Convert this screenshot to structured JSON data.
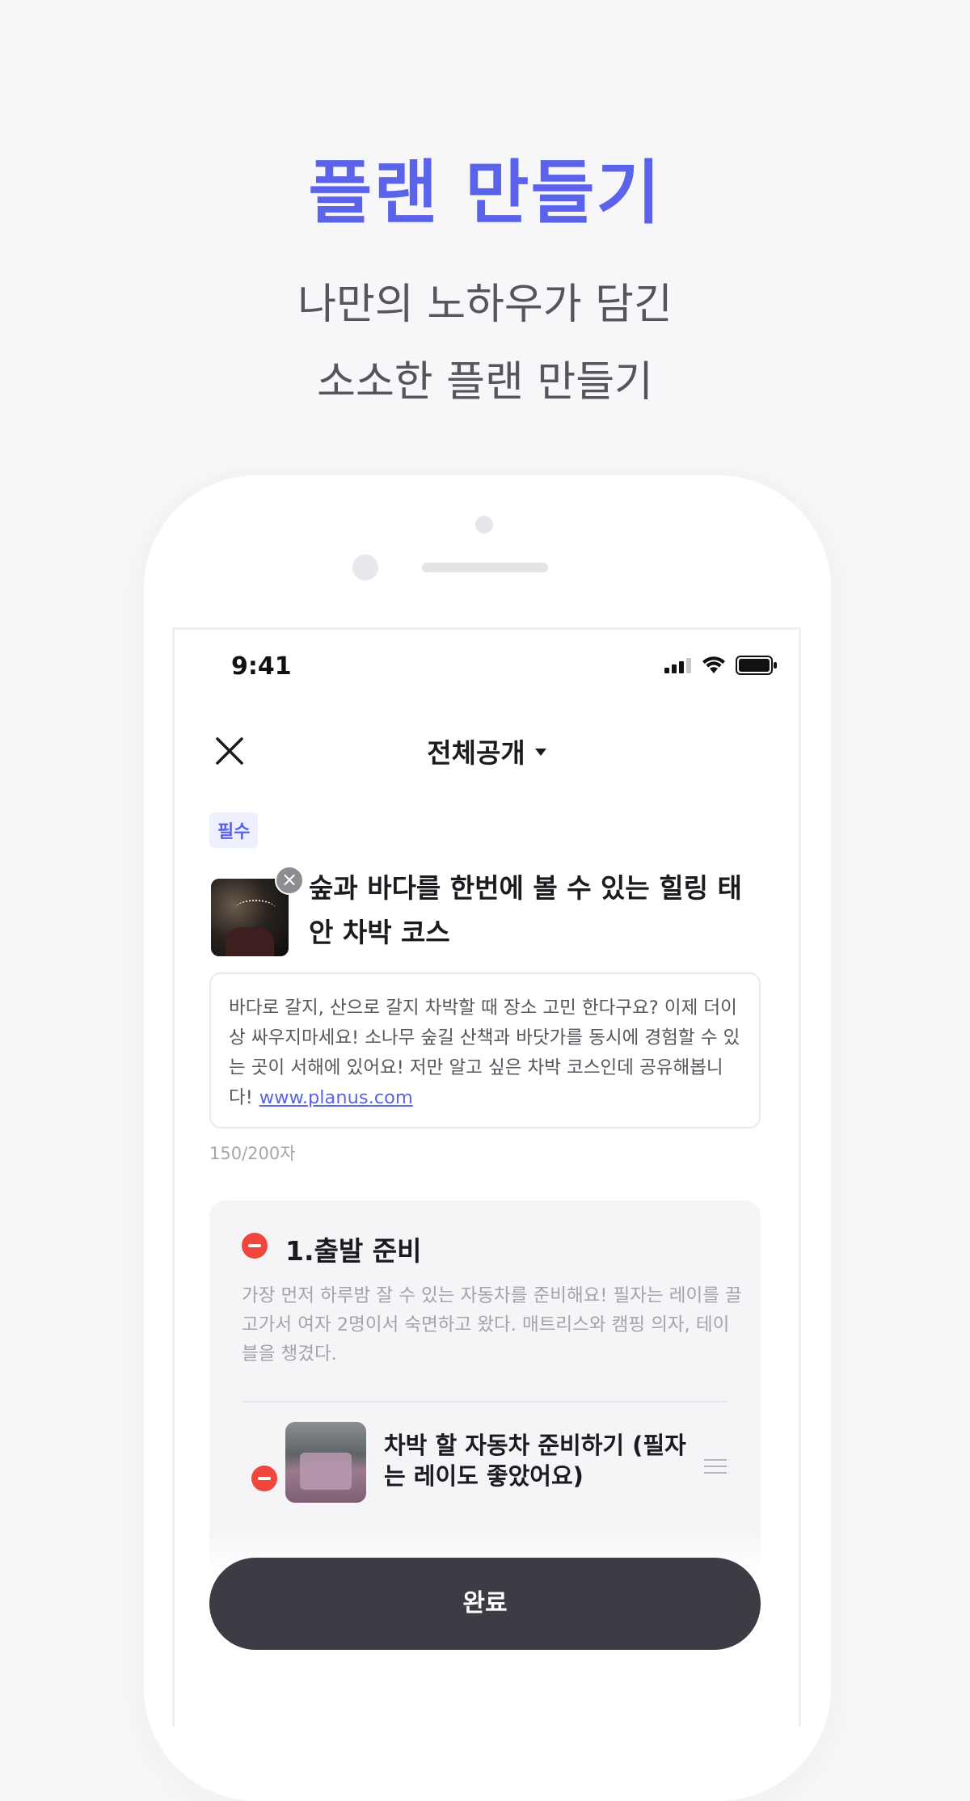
{
  "promo": {
    "headline": "플랜 만들기",
    "sub_line1": "나만의 노하우가 담긴",
    "sub_line2": "소소한 플랜 만들기"
  },
  "status_bar": {
    "time": "9:41",
    "icons": [
      "signal-icon",
      "wifi-icon",
      "battery-icon"
    ]
  },
  "header": {
    "close_icon": "close-icon",
    "visibility_label": "전체공개",
    "visibility_icon": "caret-down-icon"
  },
  "plan": {
    "required_badge": "필수",
    "title": "숲과 바다를 한번에 볼 수 있는 힐링 태안 차박 코스",
    "description": "바다로 갈지, 산으로 갈지 차박할 때 장소 고민 한다구요? 이제 더이상 싸우지마세요! 소나무 숲길 산책과 바닷가를 동시에 경험할 수 있는 곳이 서해에 있어요! 저만 알고 싶은 차박 코스인데 공유해봅니다!",
    "link": "www.planus.com",
    "char_counter": "150/200자"
  },
  "section": {
    "title": "1.출발 준비",
    "description": "가장 먼저 하루밤 잘 수 있는 자동차를 준비해요! 필자는 레이를 끌고가서 여자 2명이서 숙면하고 왔다. 매트리스와 캠핑 의자, 테이블을 챙겼다.",
    "items": [
      {
        "title": "차박 할 자동차 준비하기 (필자는 레이도 좋았어요)"
      }
    ]
  },
  "footer": {
    "done_label": "완료"
  },
  "colors": {
    "accent": "#5b63ea",
    "delete_red": "#f0463c",
    "button_dark": "#3d3c45"
  }
}
